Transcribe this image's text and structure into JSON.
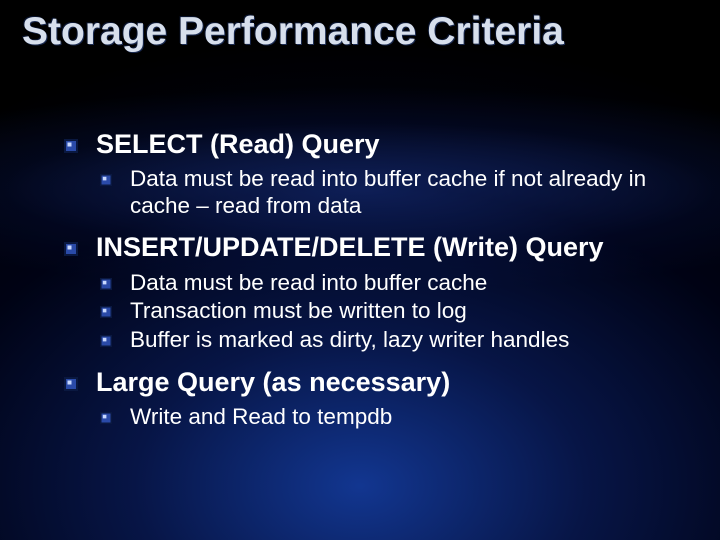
{
  "title": "Storage Performance Criteria",
  "sections": [
    {
      "heading": "SELECT (Read) Query",
      "items": [
        "Data must be read into buffer cache if not already in cache – read from data"
      ]
    },
    {
      "heading": "INSERT/UPDATE/DELETE (Write) Query",
      "items": [
        "Data must be read into buffer cache",
        "Transaction must be written to log",
        "Buffer is marked as dirty, lazy writer handles"
      ]
    },
    {
      "heading": "Large Query (as necessary)",
      "items": [
        "Write and Read to tempdb"
      ]
    }
  ]
}
